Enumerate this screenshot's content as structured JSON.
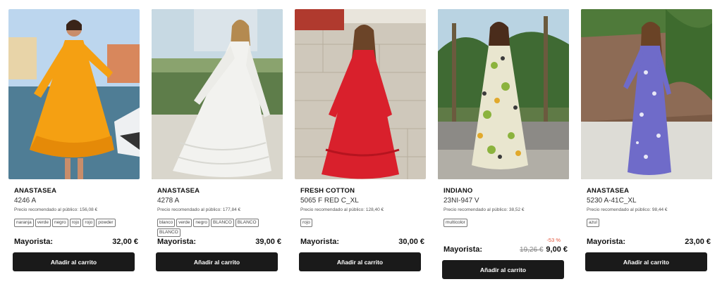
{
  "products": [
    {
      "brand": "ANASTASEA",
      "ref": "4246 A",
      "rrp": "Precio recomendado al público: 156,08 €",
      "tags": [
        "naranja",
        "verde",
        "negro",
        "rojo",
        "rojo",
        "powder"
      ],
      "price_label": "Mayorista:",
      "old_price": "",
      "price": "32,00 €",
      "discount": "",
      "button": "Añadir al carrito",
      "dress_color": "#f5a012",
      "background": "harbor"
    },
    {
      "brand": "ANASTASEA",
      "ref": "4278 A",
      "rrp": "Precio recomendado al público: 177,84 €",
      "tags": [
        "blanco",
        "verde",
        "negro",
        "BLANCO",
        "BLANCO",
        "BLANCO"
      ],
      "price_label": "Mayorista:",
      "old_price": "",
      "price": "39,00 €",
      "discount": "",
      "button": "Añadir al carrito",
      "dress_color": "#f2f2ef",
      "background": "garden"
    },
    {
      "brand": "FRESH COTTON",
      "ref": "5065 F RED C_XL",
      "rrp": "Precio recomendado al público: 128,40 €",
      "tags": [
        "rojo"
      ],
      "price_label": "Mayorista:",
      "old_price": "",
      "price": "30,00 €",
      "discount": "",
      "button": "Añadir al carrito",
      "dress_color": "#d9202c",
      "background": "stone-wall"
    },
    {
      "brand": "INDIANO",
      "ref": "23NI-947 V",
      "rrp": "Precio recomendado al público: 38,52 €",
      "tags": [
        "multicolor"
      ],
      "price_label": "Mayorista:",
      "old_price": "19,26 €",
      "price": "9,00 €",
      "discount": "-53 %",
      "button": "Añadir al carrito",
      "dress_color": "#e9e6cf",
      "background": "palms"
    },
    {
      "brand": "ANASTASEA",
      "ref": "5230 A-41C_XL",
      "rrp": "Precio recomendado al público: 98,44 €",
      "tags": [
        "azul"
      ],
      "price_label": "Mayorista:",
      "old_price": "",
      "price": "23,00 €",
      "discount": "",
      "button": "Añadir al carrito",
      "dress_color": "#6f6bc9",
      "background": "rock-garden"
    }
  ]
}
